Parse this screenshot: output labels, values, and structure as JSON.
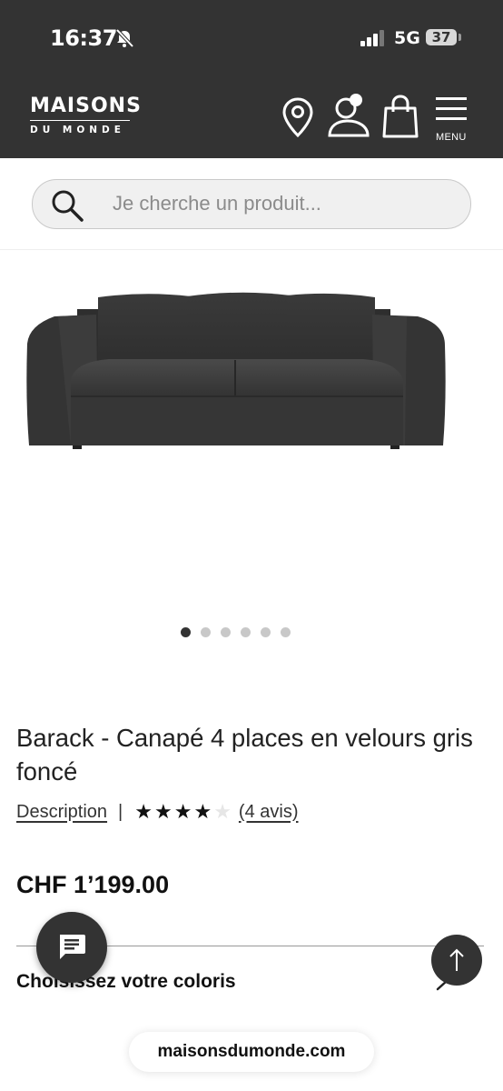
{
  "status_bar": {
    "time": "16:37",
    "network": "5G",
    "battery": "37"
  },
  "header": {
    "logo_top": "MAISONS",
    "logo_bottom": "DU MONDE",
    "menu_label": "MENU",
    "icons": [
      "location-pin-icon",
      "account-icon",
      "shopping-bag-icon",
      "hamburger-menu-icon"
    ]
  },
  "search": {
    "placeholder": "Je cherche un produit..."
  },
  "carousel": {
    "count": 6,
    "active_index": 0
  },
  "product": {
    "title": "Barack - Canapé 4 places en velours gris foncé",
    "description_link": "Description",
    "separator": "|",
    "rating": 4,
    "rating_max": 5,
    "reviews_link": "(4 avis)",
    "price": "CHF 1’199.00",
    "color_label": "Choisissez votre coloris"
  },
  "browser": {
    "url": "maisonsdumonde.com"
  },
  "colors": {
    "header_bg": "#333333",
    "sofa": "#3d3d3d"
  }
}
